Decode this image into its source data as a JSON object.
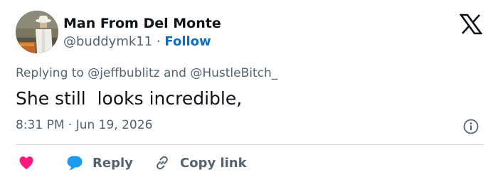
{
  "author": {
    "name": "Man From Del Monte",
    "handle": "@buddymk11",
    "separator": "·",
    "follow_label": "Follow"
  },
  "reply_context": {
    "prefix": "Replying to",
    "mentions": [
      "@jeffbublitz",
      "@HustleBitch_"
    ],
    "joiner": "and"
  },
  "tweet": {
    "text": "She still  looks incredible,",
    "timestamp": "8:31 PM · Jun 19, 2026"
  },
  "actions": {
    "reply_label": "Reply",
    "copy_link_label": "Copy link"
  },
  "icons": {
    "logo": "x-logo-icon",
    "info": "info-icon",
    "like": "heart-icon",
    "reply": "speech-bubble-icon",
    "copy": "link-icon"
  },
  "colors": {
    "like": "#f91880",
    "reply": "#1d9bf0",
    "follow": "#0a6fc2",
    "secondary_text": "#536471"
  }
}
